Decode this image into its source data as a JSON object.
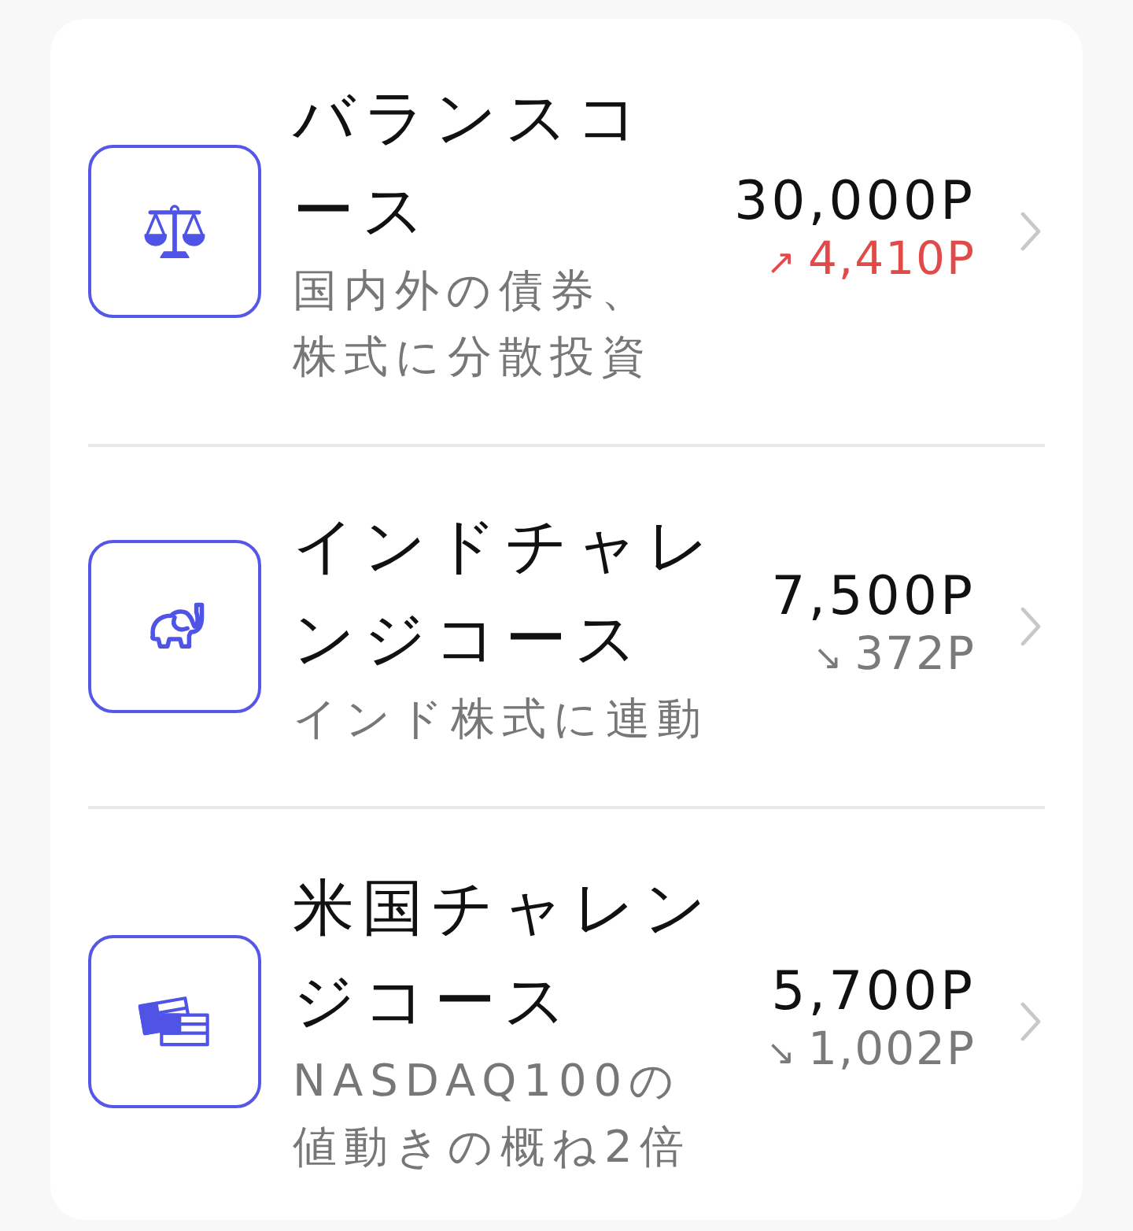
{
  "courses": [
    {
      "title": "バランスコース",
      "description": "国内外の債券、株式に分散投資",
      "amount": "30,000P",
      "arrow": "↗",
      "change": "4,410P",
      "rising": true
    },
    {
      "title": "インドチャレンジコース",
      "description": "インド株式に連動",
      "amount": "7,500P",
      "arrow": "↘",
      "change": "372P",
      "rising": false
    },
    {
      "title": "米国チャレンジコース",
      "description": "NASDAQ100の値動きの概ね2倍",
      "amount": "5,700P",
      "arrow": "↘",
      "change": "1,002P",
      "rising": false
    }
  ]
}
